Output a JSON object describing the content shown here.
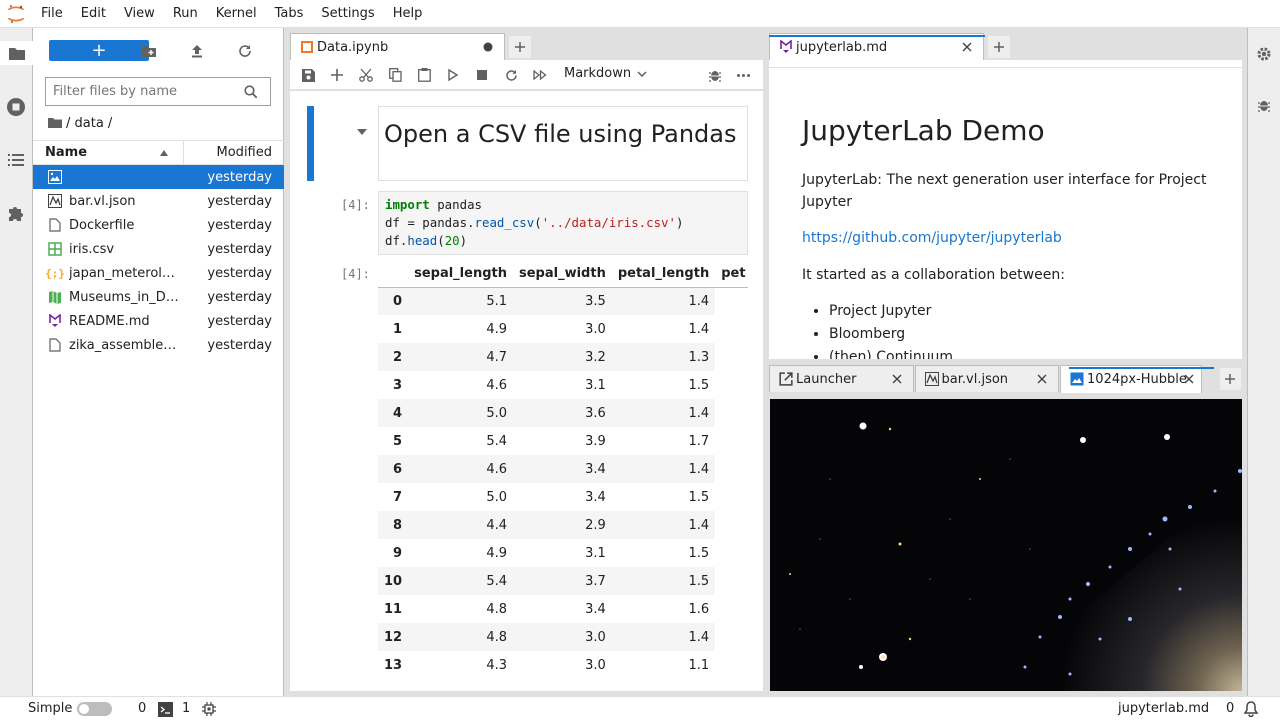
{
  "menubar": {
    "items": [
      "File",
      "Edit",
      "View",
      "Run",
      "Kernel",
      "Tabs",
      "Settings",
      "Help"
    ]
  },
  "leftbar": {
    "icons": [
      "folder-icon",
      "running-icon",
      "toc-icon",
      "extension-icon"
    ]
  },
  "rightbar": {
    "icons": [
      "property-inspector-icon",
      "debugger-icon"
    ]
  },
  "filebrowser": {
    "new_label": "+",
    "filter_placeholder": "Filter files by name",
    "breadcrumb": "/ data /",
    "header": {
      "name": "Name",
      "modified": "Modified"
    },
    "files": [
      {
        "name": "",
        "modified": "yesterday",
        "icon": "image-icon",
        "selected": true
      },
      {
        "name": "bar.vl.json",
        "modified": "yesterday",
        "icon": "vega-icon"
      },
      {
        "name": "Dockerfile",
        "modified": "yesterday",
        "icon": "file-icon"
      },
      {
        "name": "iris.csv",
        "modified": "yesterday",
        "icon": "spreadsheet-icon"
      },
      {
        "name": "japan_meterol…",
        "modified": "yesterday",
        "icon": "json-icon"
      },
      {
        "name": "Museums_in_D…",
        "modified": "yesterday",
        "icon": "geojson-icon"
      },
      {
        "name": "README.md",
        "modified": "yesterday",
        "icon": "markdown-icon"
      },
      {
        "name": "zika_assemble…",
        "modified": "yesterday",
        "icon": "file-icon"
      }
    ]
  },
  "notebook": {
    "tab_label": "Data.ipynb",
    "cell_type": "Markdown",
    "md_heading": "Open a CSV file using Pandas",
    "prompt_in": "[4]:",
    "prompt_out": "[4]:",
    "code": {
      "line1_kw": "import",
      "line1_rest": " pandas",
      "line2_a": "df = pandas.",
      "line2_fn": "read_csv",
      "line2_b": "(",
      "line2_str": "'../data/iris.csv'",
      "line2_c": ")",
      "line3_a": "df.",
      "line3_fn": "head",
      "line3_b": "(",
      "line3_num": "20",
      "line3_c": ")"
    },
    "dataframe": {
      "columns": [
        "sepal_length",
        "sepal_width",
        "petal_length",
        "pet"
      ],
      "rows": [
        [
          "0",
          "5.1",
          "3.5",
          "1.4"
        ],
        [
          "1",
          "4.9",
          "3.0",
          "1.4"
        ],
        [
          "2",
          "4.7",
          "3.2",
          "1.3"
        ],
        [
          "3",
          "4.6",
          "3.1",
          "1.5"
        ],
        [
          "4",
          "5.0",
          "3.6",
          "1.4"
        ],
        [
          "5",
          "5.4",
          "3.9",
          "1.7"
        ],
        [
          "6",
          "4.6",
          "3.4",
          "1.4"
        ],
        [
          "7",
          "5.0",
          "3.4",
          "1.5"
        ],
        [
          "8",
          "4.4",
          "2.9",
          "1.4"
        ],
        [
          "9",
          "4.9",
          "3.1",
          "1.5"
        ],
        [
          "10",
          "5.4",
          "3.7",
          "1.5"
        ],
        [
          "11",
          "4.8",
          "3.4",
          "1.6"
        ],
        [
          "12",
          "4.8",
          "3.0",
          "1.4"
        ],
        [
          "13",
          "4.3",
          "3.0",
          "1.1"
        ]
      ]
    }
  },
  "markdown": {
    "tab_label": "jupyterlab.md",
    "title": "JupyterLab Demo",
    "para1": "JupyterLab: The next generation user interface for Project Jupyter",
    "link": "https://github.com/jupyter/jupyterlab",
    "para2": "It started as a collaboration between:",
    "list": [
      "Project Jupyter",
      "Bloomberg",
      "(then) Continuum"
    ]
  },
  "image_panel": {
    "tabs": [
      "Launcher",
      "bar.vl.json",
      "1024px-Hubble"
    ]
  },
  "statusbar": {
    "mode_label": "Simple",
    "terminals": "0",
    "kernels": "1",
    "current_file": "jupyterlab.md",
    "notifications": "0"
  },
  "colors": {
    "accent": "#1976d2",
    "orange": "#f37726"
  }
}
